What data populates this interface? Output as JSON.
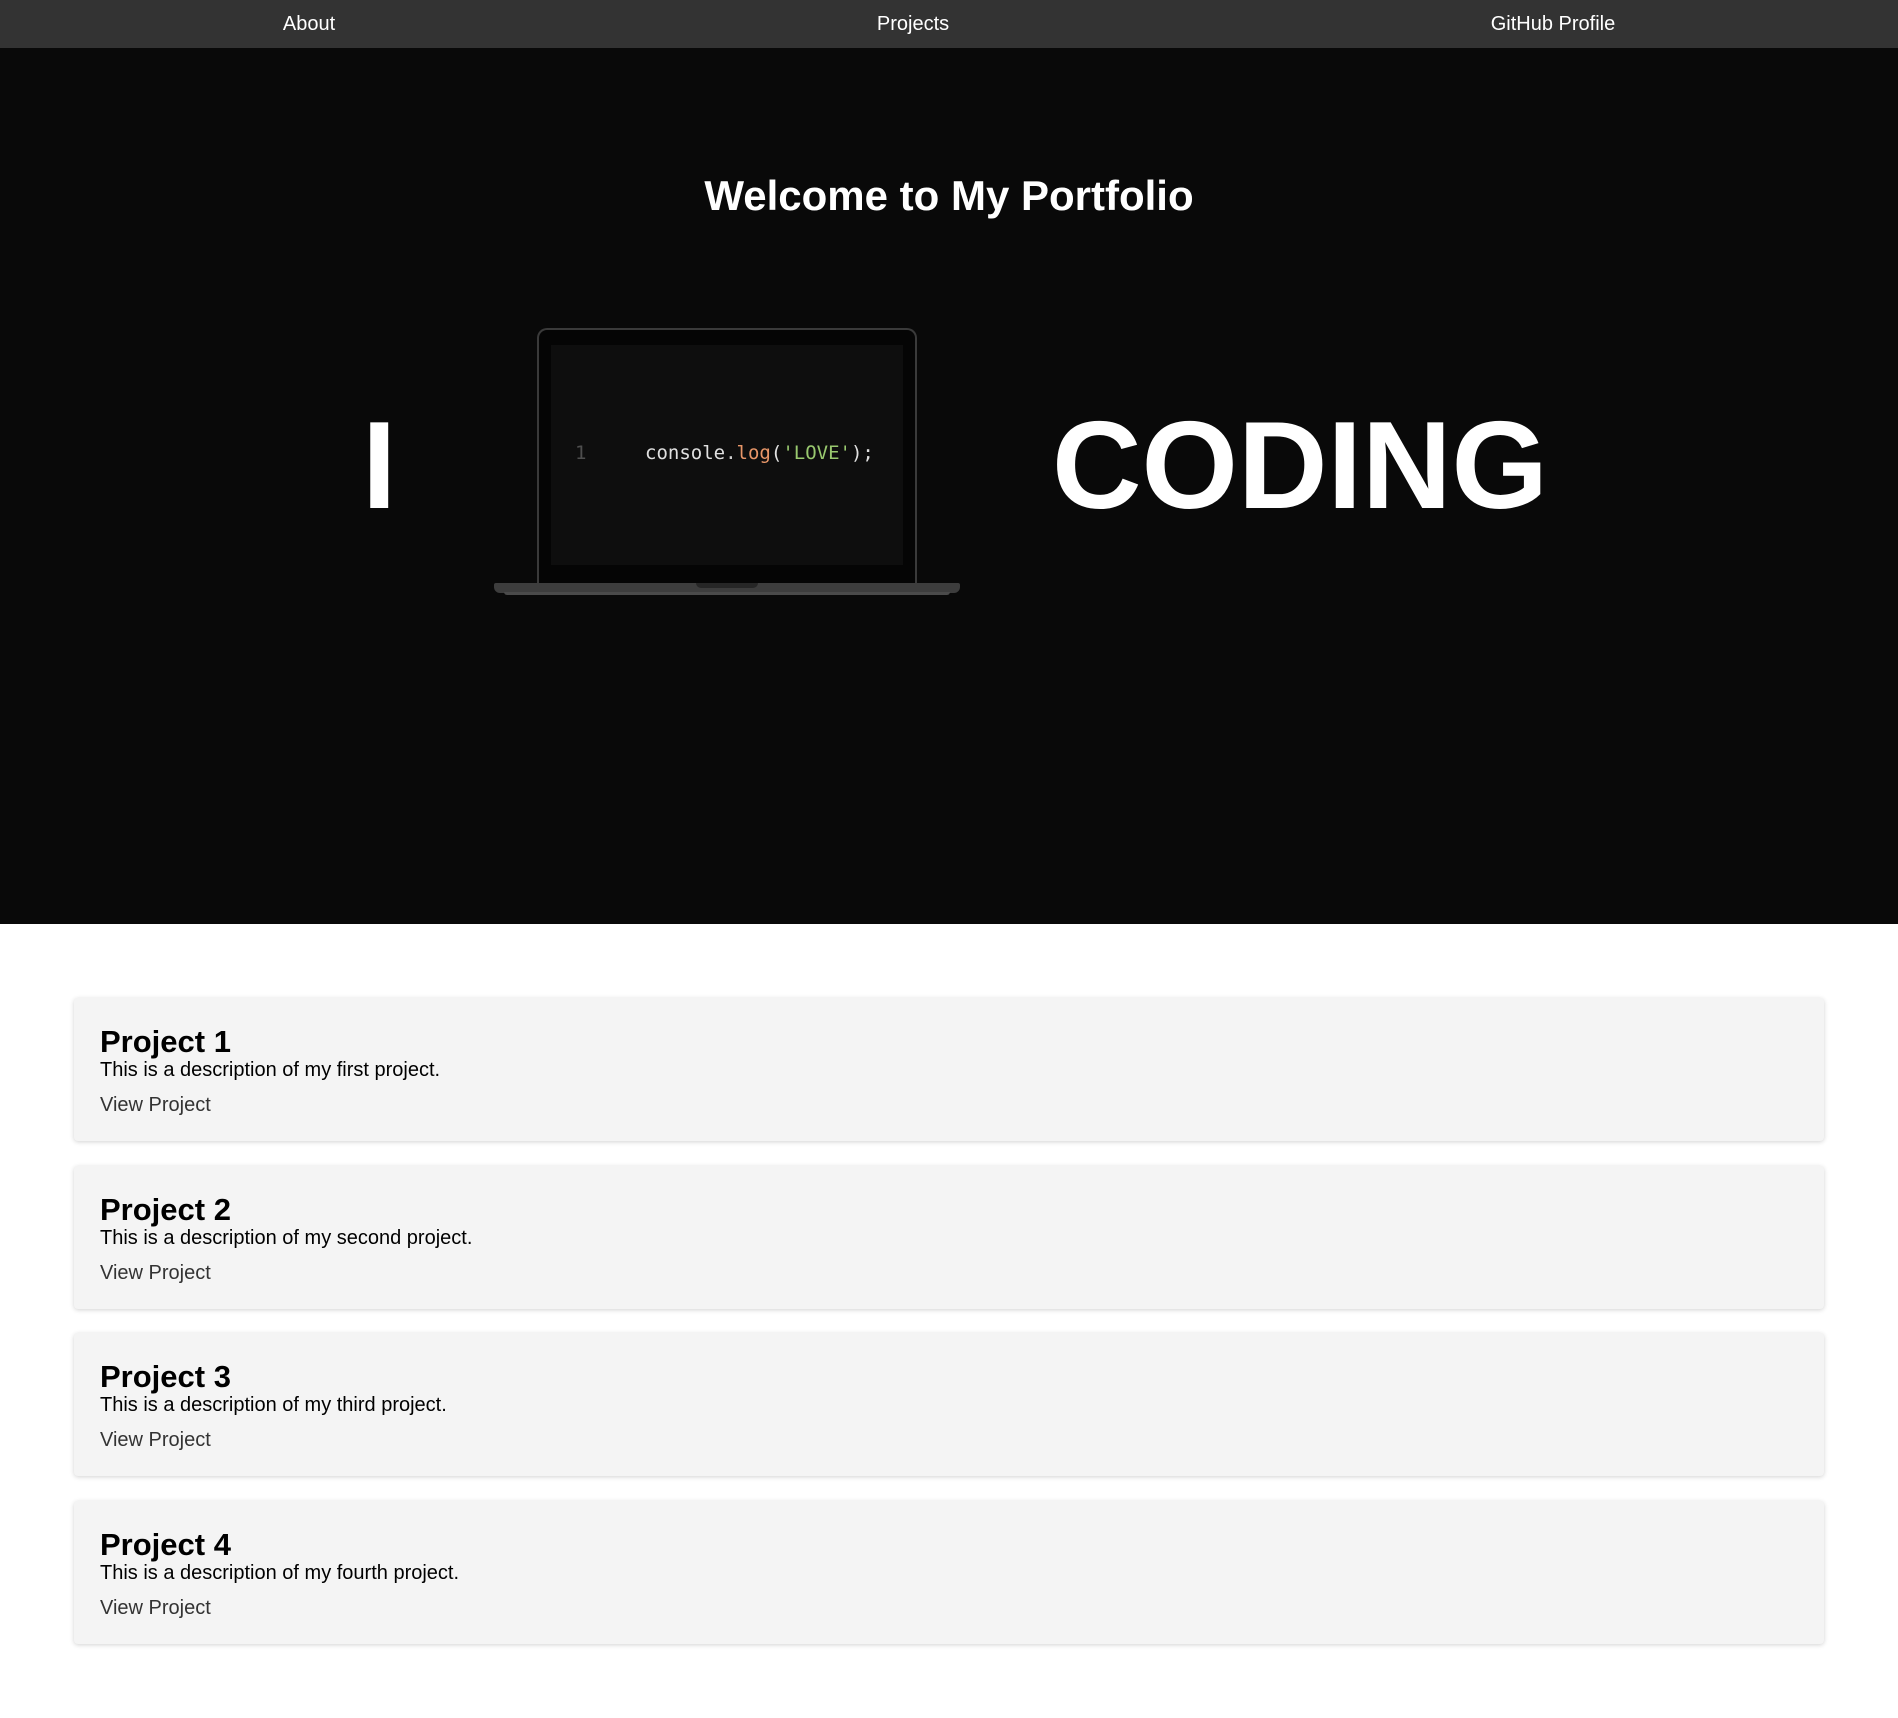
{
  "nav": {
    "items": [
      {
        "label": "About"
      },
      {
        "label": "Projects"
      },
      {
        "label": "GitHub Profile"
      }
    ]
  },
  "hero": {
    "title": "Welcome to My Portfolio",
    "left_word": "I",
    "right_word": "CODING",
    "laptop": {
      "line_number": "1",
      "code_object": "console",
      "code_dot": ".",
      "code_method": "log",
      "code_open": "(",
      "code_string": "'LOVE'",
      "code_close": ");"
    }
  },
  "projects": [
    {
      "title": "Project 1",
      "description": "This is a description of my first project.",
      "link": "View Project"
    },
    {
      "title": "Project 2",
      "description": "This is a description of my second project.",
      "link": "View Project"
    },
    {
      "title": "Project 3",
      "description": "This is a description of my third project.",
      "link": "View Project"
    },
    {
      "title": "Project 4",
      "description": "This is a description of my fourth project.",
      "link": "View Project"
    }
  ],
  "colors": {
    "nav_background": "#333333",
    "hero_background": "#090909",
    "card_background": "#f4f4f4",
    "code_method": "#e89668",
    "code_string": "#99c96f"
  }
}
